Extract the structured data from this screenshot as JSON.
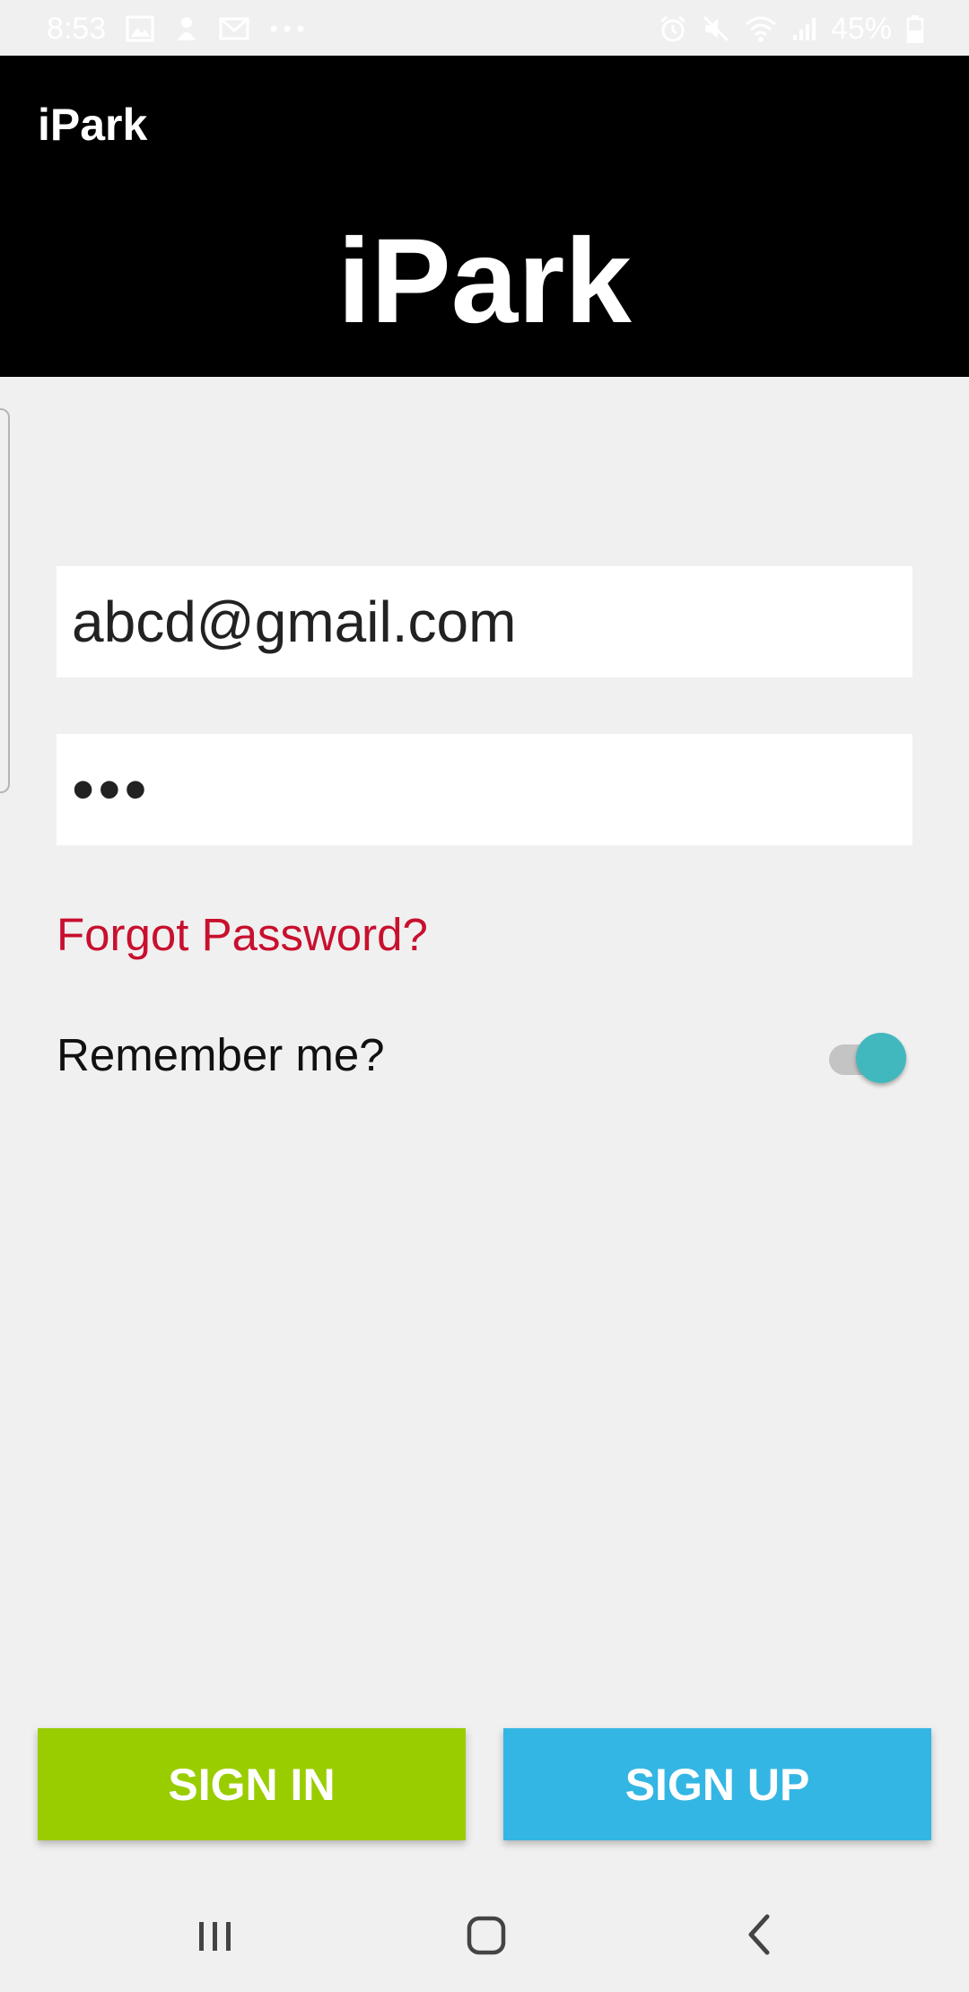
{
  "status_bar": {
    "time": "8:53",
    "battery": "45%",
    "icons": [
      "gallery-icon",
      "app-notification-icon",
      "email-icon",
      "more-icon",
      "alarm-icon",
      "mute-icon",
      "wifi-icon",
      "signal-icon",
      "battery-icon"
    ]
  },
  "header": {
    "toolbar_title": "iPark",
    "logo_title": "iPark"
  },
  "form": {
    "email_value": "abcd@gmail.com",
    "password_masked": "•••",
    "forgot_password": "Forgot Password?",
    "remember_me_label": "Remember me?",
    "remember_me_on": true
  },
  "buttons": {
    "sign_in": "SIGN IN",
    "sign_up": "SIGN UP"
  },
  "colors": {
    "header_bg": "#000000",
    "forgot_link": "#c8102e",
    "toggle_accent": "#40b8be",
    "sign_in_bg": "#9acd00",
    "sign_up_bg": "#34b6e4"
  },
  "nav_bar": {
    "icons": [
      "recent-apps-icon",
      "home-icon",
      "back-icon"
    ]
  }
}
